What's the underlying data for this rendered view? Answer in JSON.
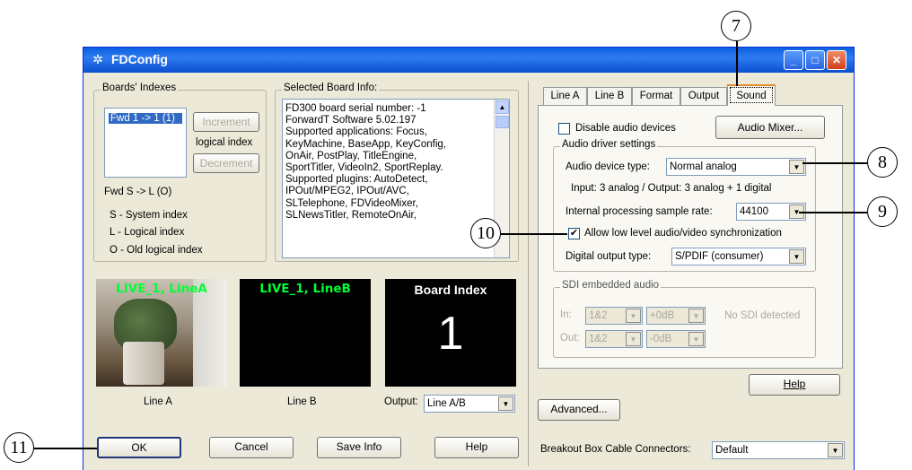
{
  "window": {
    "title": "FDConfig",
    "app_icon": "tools-icon"
  },
  "boards": {
    "group_label": "Boards' Indexes",
    "list_item": "Fwd 1 -> 1 (1)",
    "increment": "Increment",
    "logical_index": "logical index",
    "decrement": "Decrement",
    "fwd_line": "Fwd S -> L (O)",
    "legend": [
      "S - System index",
      "L - Logical index",
      "O - Old logical index"
    ]
  },
  "board_info": {
    "group_label": "Selected Board Info:",
    "lines": [
      "FD300 board serial number: -1",
      "ForwardT Software 5.02.197",
      "Supported applications: Focus,",
      "KeyMachine, BaseApp, KeyConfig,",
      "OnAir, PostPlay, TitleEngine,",
      "SportTitler, VideoIn2, SportReplay.",
      "Supported plugins: AutoDetect,",
      "IPOut/MPEG2, IPOut/AVC,",
      "SLTelephone, FDVideoMixer,",
      "SLNewsTitler, RemoteOnAir,"
    ]
  },
  "previews": {
    "a_label": "LIVE_1, LineA",
    "b_label": "LIVE_1, LineB",
    "index_title": "Board Index",
    "index_value": "1",
    "line_a": "Line A",
    "line_b": "Line B",
    "output_label": "Output:",
    "output_value": "Line A/B"
  },
  "buttons": {
    "ok": "OK",
    "cancel": "Cancel",
    "save_info": "Save Info",
    "help": "Help",
    "help_right": "Help",
    "advanced": "Advanced..."
  },
  "tabs": [
    "Line A",
    "Line B",
    "Format",
    "Output",
    "Sound"
  ],
  "sound": {
    "disable_audio": "Disable audio devices",
    "audio_mixer": "Audio Mixer...",
    "driver_group": "Audio driver settings",
    "device_type_label": "Audio device type:",
    "device_type_value": "Normal analog",
    "io_info": "Input: 3 analog / Output: 3 analog + 1 digital",
    "sample_rate_label": "Internal processing sample rate:",
    "sample_rate_value": "44100",
    "allow_sync": "Allow low level audio/video synchronization",
    "digital_out_label": "Digital output type:",
    "digital_out_value": "S/PDIF (consumer)",
    "sdi_group": "SDI embedded audio",
    "in_label": "In:",
    "out_label": "Out:",
    "in_ch": "1&2",
    "in_db": "+0dB",
    "out_ch": "1&2",
    "out_db": "-0dB",
    "no_sdi": "No SDI detected"
  },
  "breakout": {
    "label": "Breakout Box Cable Connectors:",
    "value": "Default"
  },
  "callouts": [
    "7",
    "8",
    "9",
    "10",
    "11"
  ]
}
